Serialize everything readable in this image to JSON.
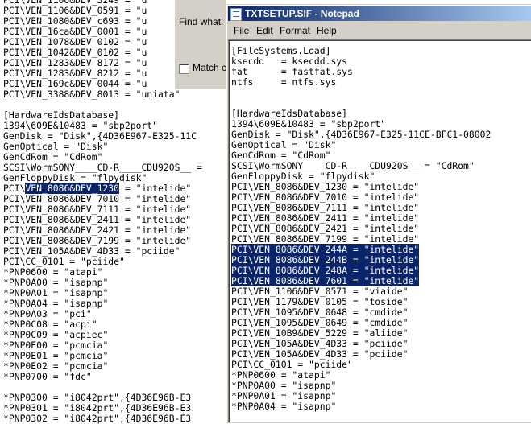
{
  "back_window": {
    "lines": [
      {
        "text": "PCI\\VEN_1106&DEV_3249 = \"u"
      },
      {
        "text": "PCI\\VEN_1106&DEV_0591 = \"u"
      },
      {
        "text": "PCI\\VEN_1080&DEV_c693 = \"u"
      },
      {
        "text": "PCI\\VEN_16ca&DEV_0001 = \"u"
      },
      {
        "text": "PCI\\VEN_1078&DEV_0102 = \"u"
      },
      {
        "text": "PCI\\VEN_1042&DEV_0102 = \"u"
      },
      {
        "text": "PCI\\VEN_1283&DEV_8172 = \"u"
      },
      {
        "text": "PCI\\VEN_1283&DEV_8212 = \"u"
      },
      {
        "text": "PCI\\VEN_169c&DEV_0044 = \"u"
      },
      {
        "text": "PCI\\VEN_3388&DEV_8013 = \"uniata\""
      },
      {
        "text": ""
      },
      {
        "text": "[HardwareIdsDatabase]"
      },
      {
        "text": "1394\\609E&10483 = \"sbp2port\""
      },
      {
        "text": "GenDisk = \"Disk\",{4D36E967-E325-11C"
      },
      {
        "text": "GenOptical = \"Disk\""
      },
      {
        "text": "GenCdRom = \"CdRom\""
      },
      {
        "text": "SCSI\\WormSONY____CD-R____CDU920S__ ="
      },
      {
        "text": "GenFloppyDisk = \"flpydisk\""
      },
      {
        "text": "PCI\\",
        "hl": "VEN_8086&DEV_1230",
        "post": " = \"intelide\""
      },
      {
        "text": "PCI\\VEN_8086&DEV_7010 = \"intelide\""
      },
      {
        "text": "PCI\\VEN_8086&DEV_7111 = \"intelide\""
      },
      {
        "text": "PCI\\VEN_8086&DEV_2411 = \"intelide\""
      },
      {
        "text": "PCI\\VEN_8086&DEV_2421 = \"intelide\""
      },
      {
        "text": "PCI\\VEN_8086&DEV_7199 = \"intelide\""
      },
      {
        "text": "PCI\\VEN_105A&DEV_4D33 = \"pciide\""
      },
      {
        "text": "PCI\\CC_0101 = \"pciide\""
      },
      {
        "text": "*PNP0600 = \"atapi\""
      },
      {
        "text": "*PNP0A00 = \"isapnp\""
      },
      {
        "text": "*PNP0A01 = \"isapnp\""
      },
      {
        "text": "*PNP0A04 = \"isapnp\""
      },
      {
        "text": "*PNP0A03 = \"pci\""
      },
      {
        "text": "*PNP0C08 = \"acpi\""
      },
      {
        "text": "*PNP0C09 = \"acpiec\""
      },
      {
        "text": "*PNP0E00 = \"pcmcia\""
      },
      {
        "text": "*PNP0E01 = \"pcmcia\""
      },
      {
        "text": "*PNP0E02 = \"pcmcia\""
      },
      {
        "text": "*PNP0700 = \"fdc\""
      },
      {
        "text": ""
      },
      {
        "text": "*PNP0300 = \"i8042prt\",{4D36E96B-E3"
      },
      {
        "text": "*PNP0301 = \"i8042prt\",{4D36E96B-E3"
      },
      {
        "text": "*PNP0302 = \"i8042prt\",{4D36E96B-E3"
      }
    ]
  },
  "find_dialog": {
    "find_what_label": "Find what:",
    "match_case_label": "Match c"
  },
  "front_window": {
    "title": "TXTSETUP.SIF - Notepad",
    "menu": [
      "File",
      "Edit",
      "Format",
      "Help"
    ],
    "lines": [
      {
        "text": "[FileSystems.Load]"
      },
      {
        "text": "ksecdd   = ksecdd.sys"
      },
      {
        "text": "fat      = fastfat.sys"
      },
      {
        "text": "ntfs     = ntfs.sys"
      },
      {
        "text": ""
      },
      {
        "text": ""
      },
      {
        "text": "[HardwareIdsDatabase]"
      },
      {
        "text": "1394\\609E&10483 = \"sbp2port\""
      },
      {
        "text": "GenDisk = \"Disk\",{4D36E967-E325-11CE-BFC1-08002"
      },
      {
        "text": "GenOptical = \"Disk\""
      },
      {
        "text": "GenCdRom = \"CdRom\""
      },
      {
        "text": "SCSI\\WormSONY____CD-R____CDU920S__ = \"CdRom\""
      },
      {
        "text": "GenFloppyDisk = \"flpydisk\""
      },
      {
        "text": "PCI\\VEN_8086&DEV_1230 = \"intelide\""
      },
      {
        "text": "PCI\\VEN_8086&DEV_7010 = \"intelide\""
      },
      {
        "text": "PCI\\VEN_8086&DEV_7111 = \"intelide\""
      },
      {
        "text": "PCI\\VEN_8086&DEV_2411 = \"intelide\""
      },
      {
        "text": "PCI\\VEN_8086&DEV_2421 = \"intelide\""
      },
      {
        "text": "PCI\\VEN_8086&DEV_7199 = \"intelide\""
      },
      {
        "text": "",
        "hl": "PCI\\VEN_8086&DEV_244A = \"intelide\""
      },
      {
        "text": "",
        "hl": "PCI\\VEN_8086&DEV_244B = \"intelide\""
      },
      {
        "text": "",
        "hl": "PCI\\VEN_8086&DEV_248A = \"intelide\""
      },
      {
        "text": "",
        "hl": "PCI\\VEN_8086&DEV_7601 = \"intelide\""
      },
      {
        "text": "PCI\\VEN_1106&DEV_0571 = \"viaide\""
      },
      {
        "text": "PCI\\VEN_1179&DEV_0105 = \"toside\""
      },
      {
        "text": "PCI\\VEN_1095&DEV_0648 = \"cmdide\""
      },
      {
        "text": "PCI\\VEN_1095&DEV_0649 = \"cmdide\""
      },
      {
        "text": "PCI\\VEN_10B9&DEV_5229 = \"aliide\""
      },
      {
        "text": "PCI\\VEN_105A&DEV_4D33 = \"pciide\""
      },
      {
        "text": "PCI\\VEN_105A&DEV_4D33 = \"pciide\""
      },
      {
        "text": "PCI\\CC_0101 = \"pciide\""
      },
      {
        "text": "*PNP0600 = \"atapi\""
      },
      {
        "text": "*PNP0A00 = \"isapnp\""
      },
      {
        "text": "*PNP0A01 = \"isapnp\""
      },
      {
        "text": "*PNP0A04 = \"isapnp\""
      }
    ]
  },
  "colors": {
    "selection": "#0a246a",
    "titlebar_start": "#0a246a",
    "titlebar_end": "#a6caf0",
    "chrome": "#d4d0c8"
  }
}
